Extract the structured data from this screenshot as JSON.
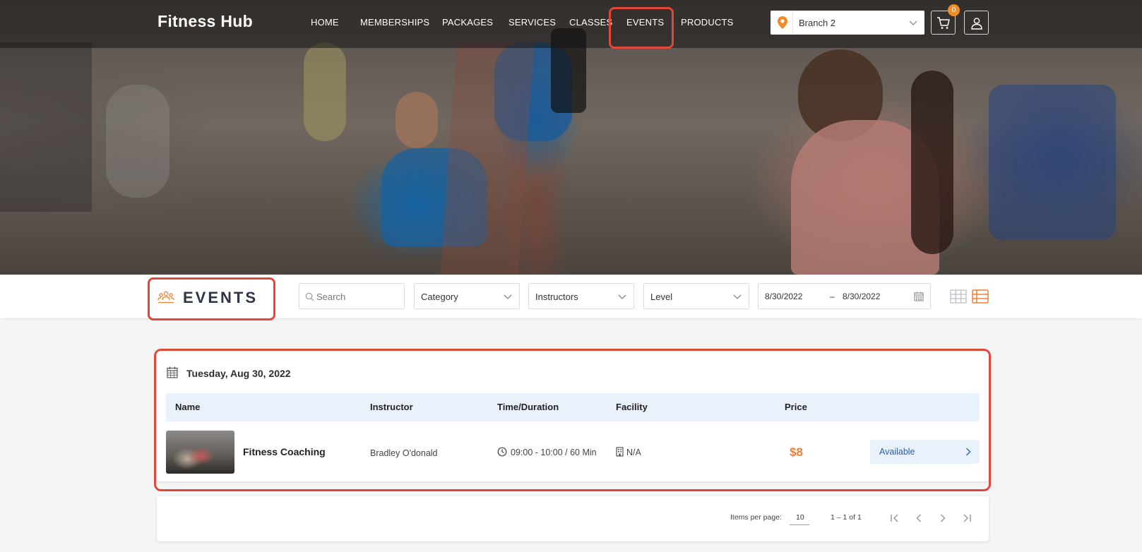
{
  "header": {
    "brand": "Fitness Hub",
    "nav": [
      {
        "label": "HOME"
      },
      {
        "label": "MEMBERSHIPS"
      },
      {
        "label": "PACKAGES"
      },
      {
        "label": "SERVICES"
      },
      {
        "label": "CLASSES"
      },
      {
        "label": "EVENTS"
      },
      {
        "label": "PRODUCTS"
      }
    ],
    "active_nav": "EVENTS",
    "branch": {
      "value": "Branch 2",
      "icon": "location-pin-icon"
    },
    "cart": {
      "count": "0",
      "icon": "cart-icon"
    },
    "account_icon": "user-icon"
  },
  "filters": {
    "title": "EVENTS",
    "title_icon": "group-icon",
    "search_placeholder": "Search",
    "category": "Category",
    "instructors": "Instructors",
    "level": "Level",
    "date_from": "8/30/2022",
    "date_separator": "–",
    "date_to": "8/30/2022",
    "views": [
      "grid-view-icon",
      "list-view-icon"
    ],
    "active_view": "list-view-icon"
  },
  "schedule": {
    "date": "Tuesday, Aug 30, 2022",
    "columns": [
      "Name",
      "Instructor",
      "Time/Duration",
      "Facility",
      "Price"
    ],
    "rows": [
      {
        "name": "Fitness Coaching",
        "instructor": "Bradley O'donald",
        "time": "09:00 - 10:00 / 60 Min",
        "facility": "N/A",
        "price": "$8",
        "status": "Available"
      }
    ]
  },
  "paginator": {
    "items_per_page_label": "Items per page:",
    "items_per_page": "10",
    "range": "1 – 1 of 1"
  },
  "colors": {
    "accent": "#ef7f34",
    "highlight": "#e0493a",
    "link": "#2a5db0",
    "row_header": "#e9f1fb"
  }
}
